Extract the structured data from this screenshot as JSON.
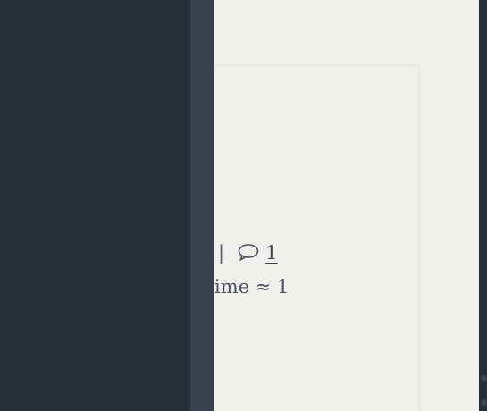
{
  "post_meta": {
    "separator": "|",
    "comment_icon": "comment-bubble-icon",
    "comment_count": "1",
    "read_time_fragment": "ime ≈ 1"
  },
  "colors": {
    "drawer_bg": "#282e38",
    "rail_bg": "#3a4050",
    "page_bg": "#f2f0ed",
    "text": "#4a5160"
  }
}
